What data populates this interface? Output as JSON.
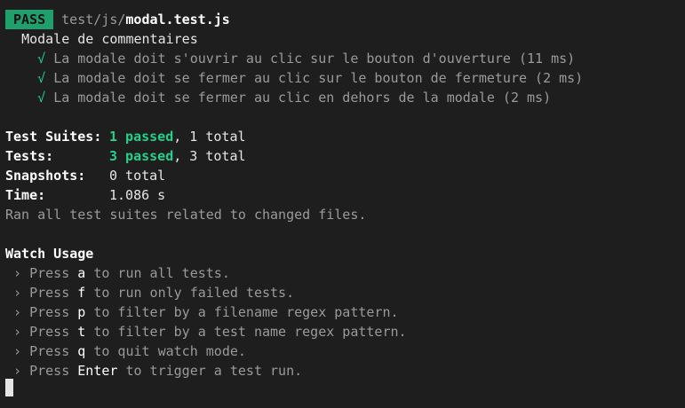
{
  "status": {
    "badge": "PASS",
    "path_dir": "test/js/",
    "path_file": "modal.test.js"
  },
  "suite": {
    "name": "Modale de commentaires",
    "tests": [
      {
        "check": "√",
        "text": "La modale doit s'ouvrir au clic sur le bouton d'ouverture (11 ms)"
      },
      {
        "check": "√",
        "text": "La modale doit se fermer au clic sur le bouton de fermeture (2 ms)"
      },
      {
        "check": "√",
        "text": "La modale doit se fermer au clic en dehors de la modale (2 ms)"
      }
    ]
  },
  "summary": {
    "suites_label": "Test Suites:",
    "suites_passed": "1 passed",
    "suites_total": ", 1 total",
    "tests_label": "Tests:",
    "tests_passed": "3 passed",
    "tests_total": ", 3 total",
    "snapshots_label": "Snapshots:",
    "snapshots_value": "0 total",
    "time_label": "Time:",
    "time_value": "1.086 s",
    "ran_all": "Ran all test suites related to changed files."
  },
  "watch": {
    "title": "Watch Usage",
    "items": [
      {
        "prefix": " › Press ",
        "key": "a",
        "suffix": " to run all tests."
      },
      {
        "prefix": " › Press ",
        "key": "f",
        "suffix": " to run only failed tests."
      },
      {
        "prefix": " › Press ",
        "key": "p",
        "suffix": " to filter by a filename regex pattern."
      },
      {
        "prefix": " › Press ",
        "key": "t",
        "suffix": " to filter by a test name regex pattern."
      },
      {
        "prefix": " › Press ",
        "key": "q",
        "suffix": " to quit watch mode."
      },
      {
        "prefix": " › Press ",
        "key": "Enter",
        "suffix": " to trigger a test run."
      }
    ]
  },
  "colors": {
    "background": "#1e1e1e",
    "pass_badge": "#1e9f6b",
    "green": "#23d18b",
    "dim": "#9a9a9a"
  }
}
